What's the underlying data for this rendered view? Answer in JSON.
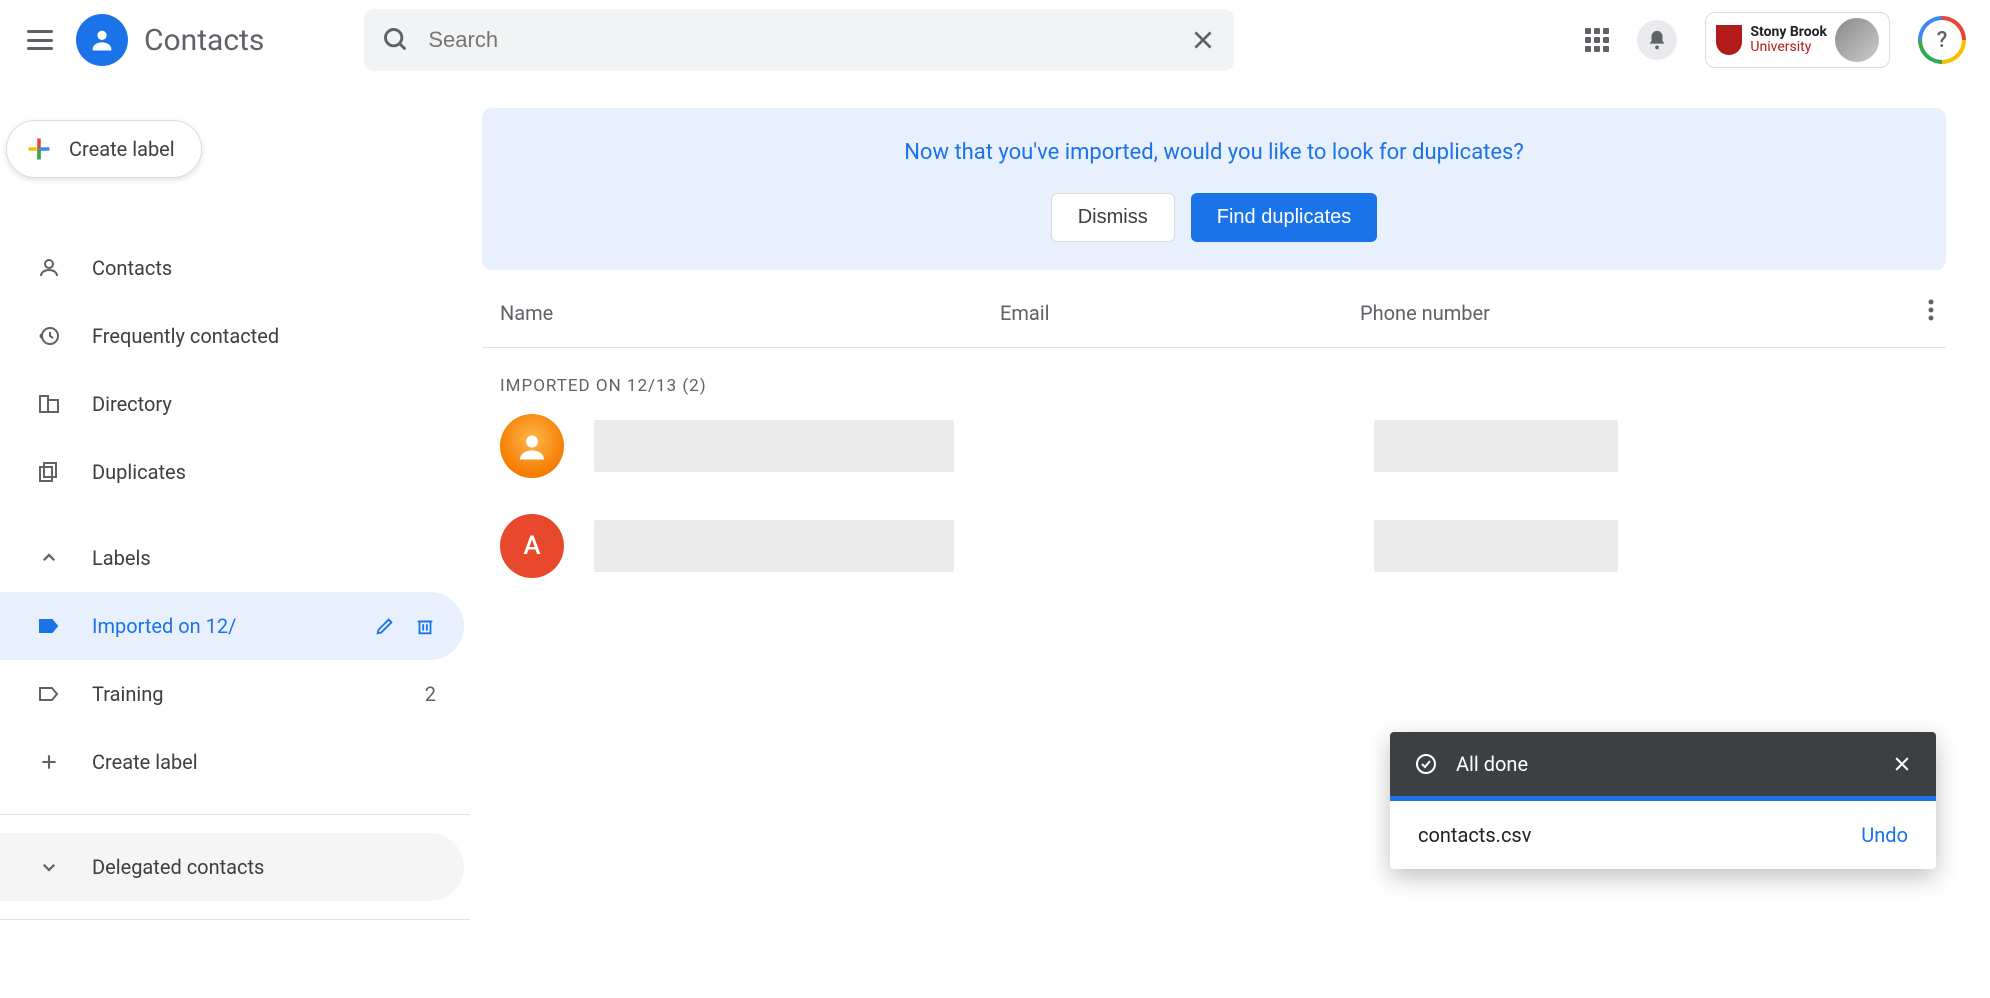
{
  "header": {
    "app_title": "Contacts",
    "search_placeholder": "Search",
    "org_name_top": "Stony Brook",
    "org_name_bottom": "University",
    "help_symbol": "?"
  },
  "sidebar": {
    "create_label": "Create label",
    "nav": {
      "contacts": "Contacts",
      "frequent": "Frequently contacted",
      "directory": "Directory",
      "duplicates": "Duplicates"
    },
    "labels_header": "Labels",
    "labels": [
      {
        "name": "Imported on 12/",
        "count": "",
        "active": true
      },
      {
        "name": "Training",
        "count": "2",
        "active": false
      }
    ],
    "create_label_text": "Create label",
    "delegated": "Delegated contacts"
  },
  "banner": {
    "text": "Now that you've imported, would you like to look for duplicates?",
    "dismiss": "Dismiss",
    "find": "Find duplicates"
  },
  "table": {
    "col_name": "Name",
    "col_email": "Email",
    "col_phone": "Phone number",
    "group_title": "IMPORTED ON 12/13 (2)"
  },
  "rows": [
    {
      "avatar_letter": "",
      "avatar_type": "default"
    },
    {
      "avatar_letter": "A",
      "avatar_type": "letter"
    }
  ],
  "toast": {
    "title": "All done",
    "file": "contacts.csv",
    "undo": "Undo"
  }
}
